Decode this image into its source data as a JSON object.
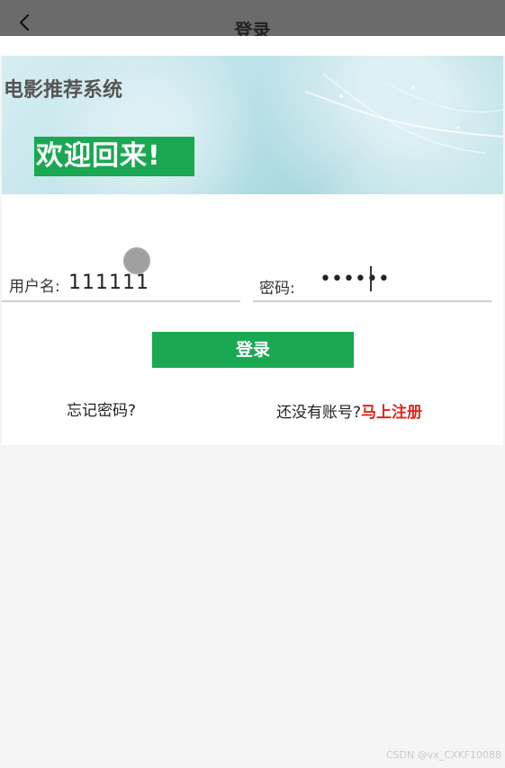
{
  "header": {
    "title": "登录",
    "back_icon": "chevron-left-icon"
  },
  "banner": {
    "system_title": "电影推荐系统",
    "welcome_text": "欢迎回来!"
  },
  "form": {
    "username_label": "用户名:",
    "username_value": "111111",
    "password_label": "密码:",
    "password_value": "••••••"
  },
  "actions": {
    "login_label": "登录",
    "forgot_label": "忘记密码?",
    "register_prompt": "还没有账号?",
    "register_label": "马上注册"
  },
  "watermark": "CSDN @vx_CXKF10088",
  "colors": {
    "topbar": "#6b6b6b",
    "accent_green": "#1aa853",
    "link_red": "#e2231a",
    "page_bg": "#f5f5f5"
  }
}
